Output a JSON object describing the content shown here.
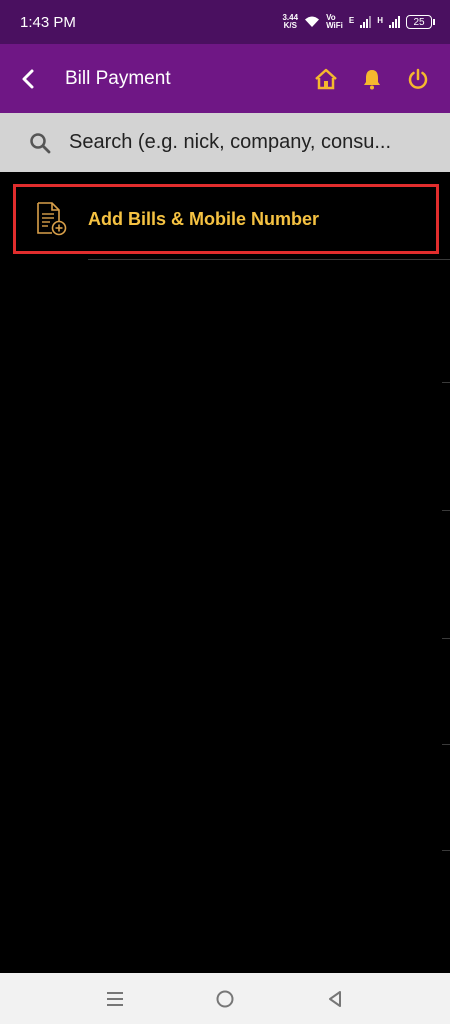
{
  "status_bar": {
    "time": "1:43 PM",
    "speed_value": "3.44",
    "speed_unit": "K/S",
    "volte_top": "Vo",
    "volte_bottom": "WiFi",
    "net1": "E",
    "net2": "H",
    "battery": "25"
  },
  "app_bar": {
    "title": "Bill Payment",
    "back_icon": "chevron-left-icon",
    "actions": [
      "home-icon",
      "bell-icon",
      "power-icon"
    ],
    "accent_color": "#f5b82e",
    "background_color": "#6f1785"
  },
  "search": {
    "placeholder": "Search (e.g. nick, company, consu..."
  },
  "list": {
    "add_bill_label": "Add Bills & Mobile Number",
    "add_bill_icon": "document-add-icon",
    "highlight_color": "#e02d2d"
  },
  "nav_bar": {
    "buttons": [
      "menu-icon",
      "home-circle-icon",
      "back-triangle-icon"
    ]
  }
}
